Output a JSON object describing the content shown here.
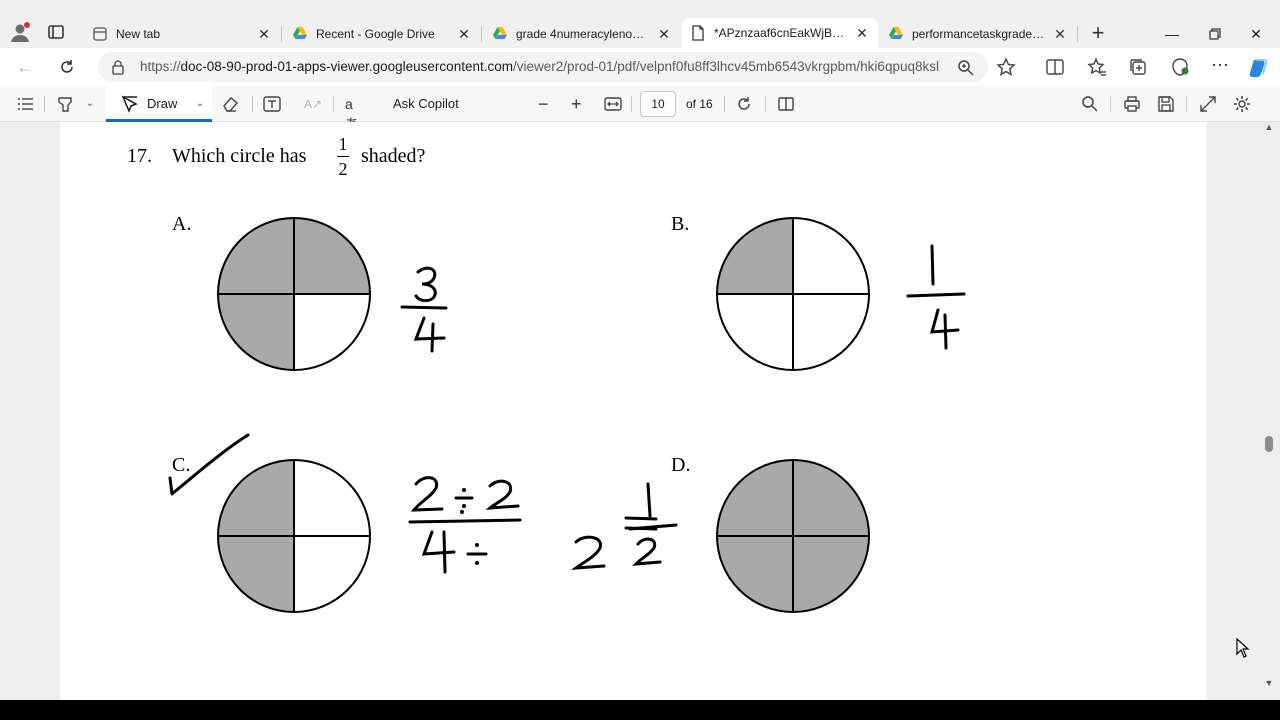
{
  "tabs": [
    {
      "title": "New tab",
      "icon": "new-tab-page-icon",
      "active": false
    },
    {
      "title": "Recent - Google Drive",
      "icon": "google-drive-icon",
      "active": false
    },
    {
      "title": "grade 4numeracylenoxbenn",
      "icon": "google-drive-icon",
      "active": false
    },
    {
      "title": "*APznzaaf6cnEakWjBuG0lE",
      "icon": "pdf-document-icon",
      "active": true
    },
    {
      "title": "performancetaskgrade4 - G",
      "icon": "google-drive-icon",
      "active": false
    }
  ],
  "address": {
    "url_prefix": "https://",
    "url_host": "doc-08-90-prod-01-apps-viewer.googleusercontent.com",
    "url_path": "/viewer2/prod-01/pdf/velpnf0fu8ff3lhcv45mb6543vkrgpbm/hki6qpuq8ksl..."
  },
  "pdf_toolbar": {
    "draw_label": "Draw",
    "ask_copilot_label": "Ask Copilot",
    "page_current": "10",
    "page_total_label": "of 16"
  },
  "document": {
    "question_number": "17.",
    "question_text_before": "Which circle has",
    "fraction_numerator": "1",
    "fraction_denominator": "2",
    "question_text_after": "shaded?",
    "options": [
      {
        "label": "A.",
        "shaded_quarters": 3,
        "handwritten": "3/4"
      },
      {
        "label": "B.",
        "shaded_quarters": 1,
        "handwritten": "1/4"
      },
      {
        "label": "C.",
        "shaded_quarters": 2,
        "handwritten": "2÷2 / 4÷2 = 1/2",
        "checked": true
      },
      {
        "label": "D.",
        "shaded_quarters": 4,
        "handwritten": ""
      }
    ]
  },
  "colors": {
    "accent": "#0f6cbd",
    "shade": "#a9a9a9",
    "page": "#ffffff",
    "viewer_bg": "#eeeeee"
  }
}
